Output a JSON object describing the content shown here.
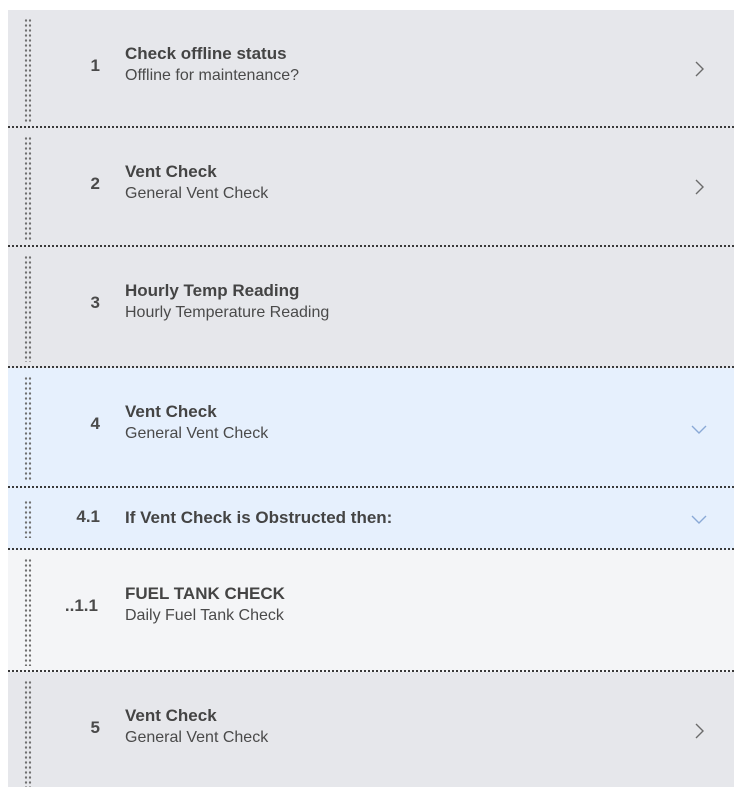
{
  "steps": [
    {
      "number": "1",
      "title": "Check offline status",
      "subtitle": "Offline for maintenance?",
      "chevron": "chevron-right-icon"
    },
    {
      "number": "2",
      "title": "Vent Check",
      "subtitle": "General Vent Check",
      "chevron": "chevron-right-icon"
    },
    {
      "number": "3",
      "title": "Hourly Temp Reading",
      "subtitle": "Hourly Temperature Reading",
      "chevron": ""
    },
    {
      "number": "4",
      "title": "Vent Check",
      "subtitle": "General Vent Check",
      "chevron": "chevron-down-icon"
    },
    {
      "number": "4.1",
      "title": "If Vent Check is Obstructed then:",
      "subtitle": "",
      "chevron": "chevron-down-icon"
    },
    {
      "number": "..1.1",
      "title": "FUEL TANK CHECK",
      "subtitle": "Daily Fuel Tank Check",
      "chevron": ""
    },
    {
      "number": "5",
      "title": "Vent Check",
      "subtitle": "General Vent Check",
      "chevron": "chevron-right-icon"
    }
  ],
  "colors": {
    "row_gray": "#e6e7eb",
    "row_selected": "#e6f0fd",
    "row_light": "#f4f5f7",
    "chevron_gray": "#6b6b6b",
    "chevron_blue": "#8aa9d6"
  }
}
